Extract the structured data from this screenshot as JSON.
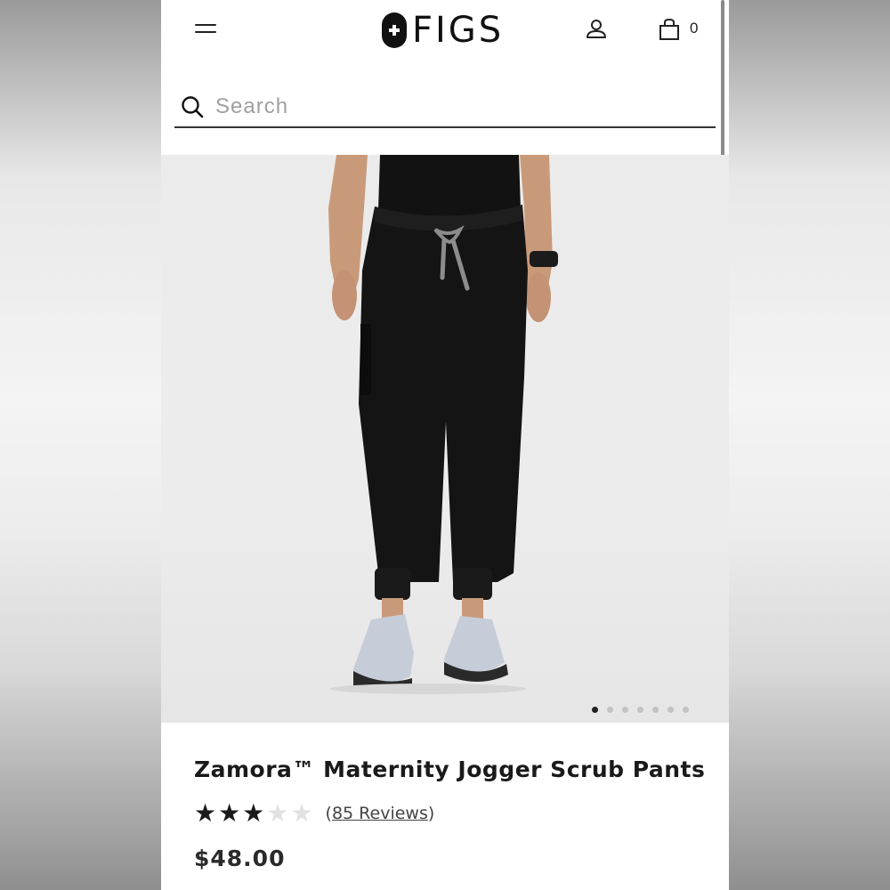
{
  "header": {
    "logo_text": "FIGS",
    "cart_count": "0",
    "icons": [
      "hamburger-menu-icon",
      "figs-plus-icon",
      "user-account-icon",
      "shopping-bag-icon"
    ]
  },
  "search": {
    "placeholder": "Search",
    "value": ""
  },
  "gallery": {
    "current_index": 1,
    "total_images": 7
  },
  "product": {
    "title": "Zamora™ Maternity Jogger Scrub Pants",
    "rating": 3,
    "max_rating": 5,
    "review_open": "(",
    "review_link": "85 Reviews",
    "review_close": ")",
    "price": "$48.00"
  },
  "colors": {
    "text": "#1a1a1a",
    "page_background": "#ffffff",
    "image_background": "#ebebeb",
    "pants": "#111111",
    "drawstring": "#8c8c8c",
    "star_filled": "#1a1a1a",
    "star_empty": "#e2e2e2"
  }
}
